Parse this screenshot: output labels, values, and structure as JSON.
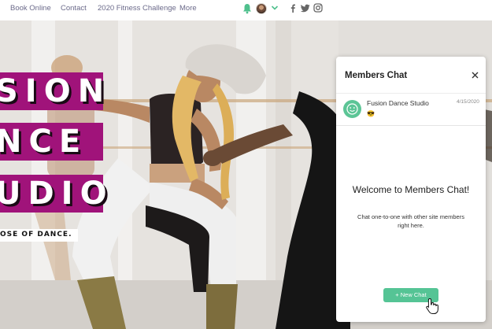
{
  "nav": {
    "items": [
      {
        "label": "Book Online"
      },
      {
        "label": "Contact"
      },
      {
        "label": "2020 Fitness Challenge"
      },
      {
        "label": "More"
      }
    ],
    "icons": [
      "bell-icon",
      "avatar",
      "chevron-down-icon"
    ],
    "social": [
      "facebook-icon",
      "twitter-icon",
      "instagram-icon"
    ],
    "accent_color": "#5cc596",
    "link_color": "#6b6a8a"
  },
  "hero": {
    "lines": [
      "SION",
      "NCE",
      "UDIO"
    ],
    "tagline": "OSE OF DANCE.",
    "banner_color": "#a0137a"
  },
  "chat": {
    "title": "Members Chat",
    "conversation": {
      "name": "Fusion Dance Studio",
      "date": "4/15/2020",
      "message": "😎"
    },
    "welcome_title": "Welcome to Members Chat!",
    "welcome_body": "Chat one-to-one with other site members right here.",
    "new_chat_label": "+ New Chat",
    "button_color": "#55c495"
  }
}
